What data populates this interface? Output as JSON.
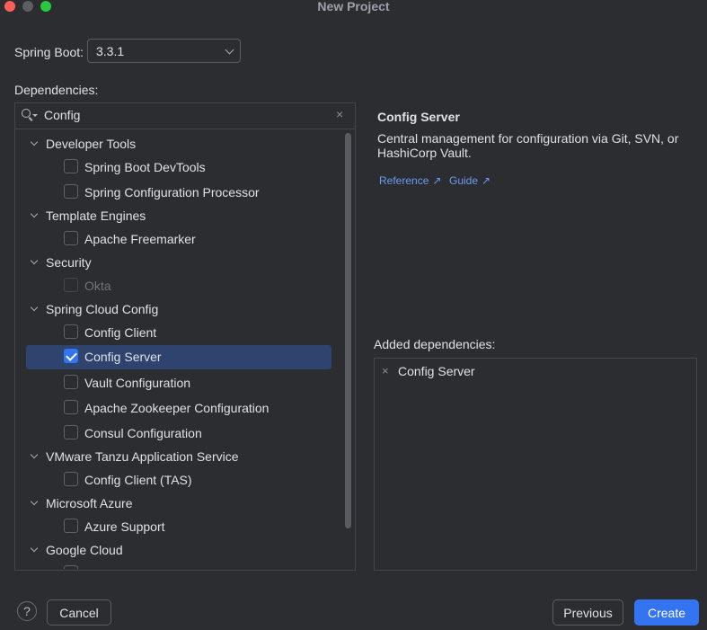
{
  "window": {
    "title": "New Project",
    "traffic_colors": {
      "close": "#ff5f57",
      "minimize": "#5c5e62",
      "maximize": "#28c840"
    }
  },
  "spring_boot": {
    "label": "Spring Boot:",
    "value": "3.3.1"
  },
  "dependencies_label": "Dependencies:",
  "search": {
    "value": "Config",
    "clear_icon": "×"
  },
  "tree": {
    "groups": [
      {
        "label": "Developer Tools",
        "items": [
          {
            "label": "Spring Boot DevTools",
            "checked": false,
            "disabled": false
          },
          {
            "label": "Spring Configuration Processor",
            "checked": false,
            "disabled": false
          }
        ]
      },
      {
        "label": "Template Engines",
        "items": [
          {
            "label": "Apache Freemarker",
            "checked": false,
            "disabled": false
          }
        ]
      },
      {
        "label": "Security",
        "items": [
          {
            "label": "Okta",
            "checked": false,
            "disabled": true
          }
        ]
      },
      {
        "label": "Spring Cloud Config",
        "items": [
          {
            "label": "Config Client",
            "checked": false,
            "disabled": false
          },
          {
            "label": "Config Server",
            "checked": true,
            "disabled": false,
            "selected": true
          },
          {
            "label": "Vault Configuration",
            "checked": false,
            "disabled": false
          },
          {
            "label": "Apache Zookeeper Configuration",
            "checked": false,
            "disabled": false
          },
          {
            "label": "Consul Configuration",
            "checked": false,
            "disabled": false
          }
        ]
      },
      {
        "label": "VMware Tanzu Application Service",
        "items": [
          {
            "label": "Config Client (TAS)",
            "checked": false,
            "disabled": false
          }
        ]
      },
      {
        "label": "Microsoft Azure",
        "items": [
          {
            "label": "Azure Support",
            "checked": false,
            "disabled": false
          }
        ]
      },
      {
        "label": "Google Cloud",
        "items": []
      }
    ]
  },
  "detail": {
    "title": "Config Server",
    "description": "Central management for configuration via Git, SVN, or HashiCorp Vault.",
    "links": {
      "reference": "Reference",
      "guide": "Guide",
      "arrow": "↗"
    }
  },
  "added": {
    "label": "Added dependencies:",
    "items": [
      {
        "label": "Config Server",
        "remove_icon": "×"
      }
    ]
  },
  "footer": {
    "help": "?",
    "cancel": "Cancel",
    "previous": "Previous",
    "create": "Create"
  },
  "accent_color": "#3574f0",
  "selection_color": "#2e436e"
}
